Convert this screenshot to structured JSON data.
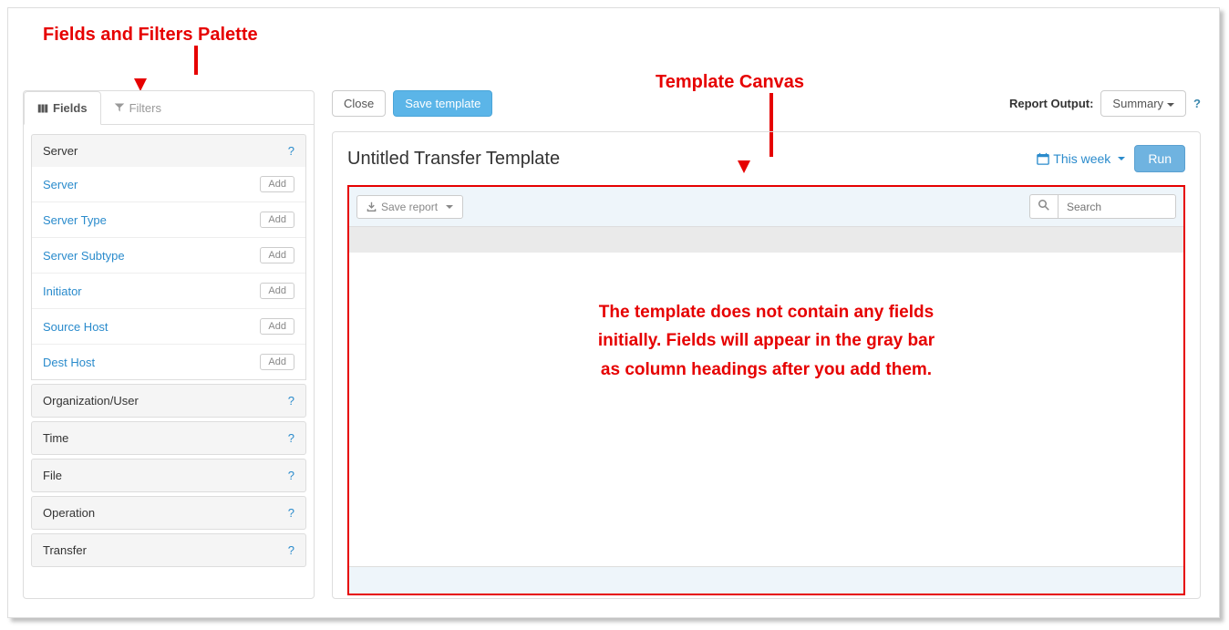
{
  "annotations": {
    "palette_label": "Fields and Filters Palette",
    "canvas_label": "Template Canvas",
    "empty_note_line1": "The template does not contain any fields",
    "empty_note_line2": "initially. Fields will appear in the gray bar",
    "empty_note_line3": "as column headings after you add them."
  },
  "toolbar": {
    "close_label": "Close",
    "save_template_label": "Save template",
    "report_output_label": "Report Output:",
    "report_output_value": "Summary"
  },
  "sidebar": {
    "tabs": {
      "fields": "Fields",
      "filters": "Filters"
    },
    "add_label": "Add",
    "groups": [
      {
        "name": "Server",
        "open": true,
        "fields": [
          "Server",
          "Server Type",
          "Server Subtype",
          "Initiator",
          "Source Host",
          "Dest Host"
        ]
      },
      {
        "name": "Organization/User",
        "open": false
      },
      {
        "name": "Time",
        "open": false
      },
      {
        "name": "File",
        "open": false
      },
      {
        "name": "Operation",
        "open": false
      },
      {
        "name": "Transfer",
        "open": false
      }
    ]
  },
  "canvas": {
    "title": "Untitled Transfer Template",
    "date_range": "This week",
    "run_label": "Run",
    "save_report_label": "Save report",
    "search_placeholder": "Search"
  }
}
